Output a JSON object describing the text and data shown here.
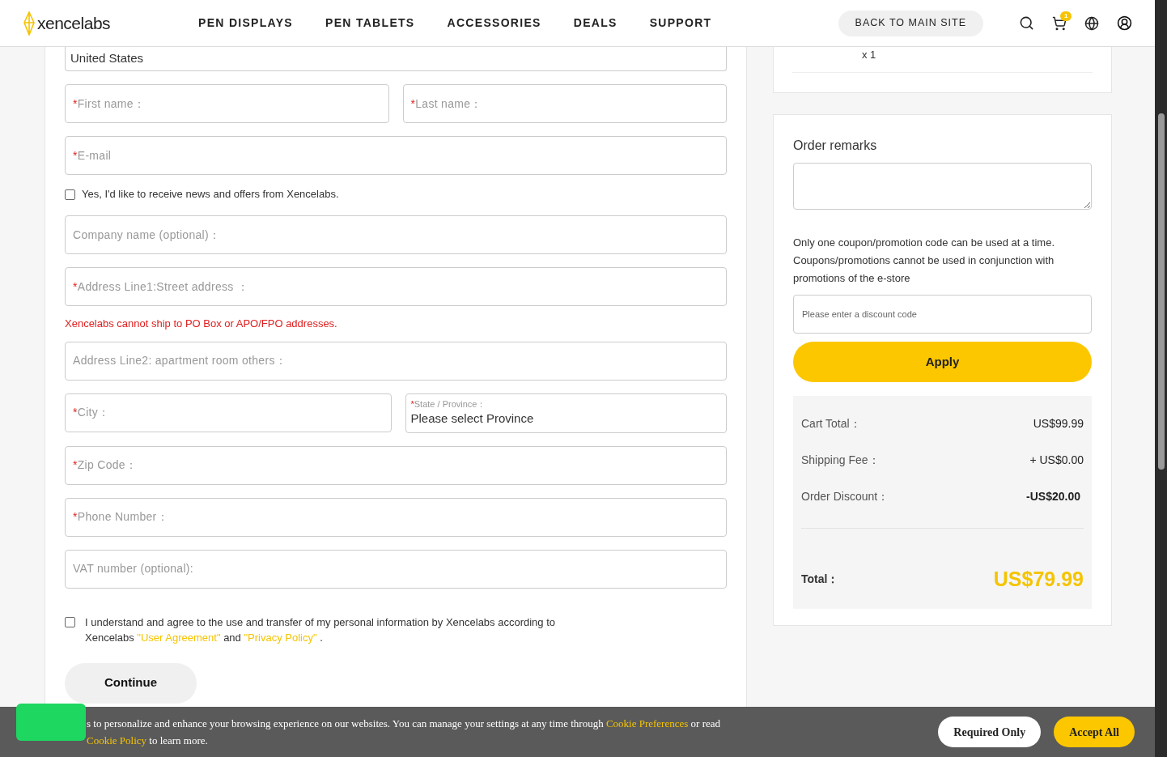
{
  "header": {
    "logo": "xencelabs",
    "nav": [
      "PEN DISPLAYS",
      "PEN TABLETS",
      "ACCESSORIES",
      "DEALS",
      "SUPPORT"
    ],
    "back_button": "BACK TO MAIN SITE",
    "cart_count": "1"
  },
  "form": {
    "country": "United States",
    "rows": [
      [
        {
          "kind": "text",
          "marker": "*",
          "placeholder": "First name："
        },
        {
          "kind": "text",
          "marker": "*",
          "placeholder": "Last name："
        }
      ],
      [
        {
          "kind": "text",
          "marker": "*",
          "placeholder": "E-mail"
        }
      ],
      [
        {
          "kind": "checkbox",
          "checked": false,
          "label": "Yes, I'd like to receive news and offers from Xencelabs."
        }
      ],
      [
        {
          "kind": "text",
          "placeholder": "Company name (optional)："
        }
      ],
      [
        {
          "kind": "text",
          "marker": "*",
          "placeholder": "Address Line1:Street address ："
        }
      ],
      [
        {
          "kind": "note",
          "text": "Xencelabs cannot ship to PO Box or APO/FPO addresses."
        }
      ],
      [
        {
          "kind": "text",
          "placeholder": "Address Line2: apartment room others："
        }
      ],
      [
        {
          "kind": "text",
          "marker": "*",
          "placeholder": "City："
        },
        {
          "kind": "select",
          "marker": "*",
          "label": "State / Province：",
          "value": "Please select Province"
        }
      ],
      [
        {
          "kind": "text",
          "marker": "*",
          "placeholder": "Zip Code："
        }
      ],
      [
        {
          "kind": "text",
          "marker": "*",
          "placeholder": "Phone Number："
        }
      ],
      [
        {
          "kind": "text",
          "placeholder": "VAT number (optional):"
        }
      ]
    ],
    "agreement": {
      "checked": false,
      "text": "I understand and agree to the use and transfer of my personal information by Xencelabs according to Xencelabs",
      "link1": "\"User Agreement\"",
      "and": "and",
      "link2": "\"Privacy Policy\"",
      "end": "."
    },
    "continue": "Continue"
  },
  "cart_item": {
    "quantity": "x 1"
  },
  "order": {
    "remarks_label": "Order remarks",
    "coupon_note": "Only one coupon/promotion code can be used at a time. Coupons/promotions cannot be used in conjunction with promotions of the e-store",
    "discount_placeholder": "Please enter a discount code",
    "apply": "Apply",
    "summary": [
      {
        "label": "Cart Total：",
        "value": "US$99.99",
        "bold": false
      },
      {
        "label": "Shipping Fee：",
        "value": "+ US$0.00",
        "bold": false
      },
      {
        "label": "Order Discount：",
        "value": "-US$20.00",
        "bold": true
      }
    ],
    "total_label": "Total：",
    "total": "US$79.99"
  },
  "cookie_banner": {
    "text_start": "s to personalize and enhance your browsing experience on our websites. You can manage your settings at any time through",
    "preferences_link": "Cookie Preferences",
    "text_mid": "or read",
    "policy_link": "Cookie Policy",
    "text_end": "to learn more.",
    "buttons": [
      "Required Only",
      "Accept All"
    ]
  }
}
